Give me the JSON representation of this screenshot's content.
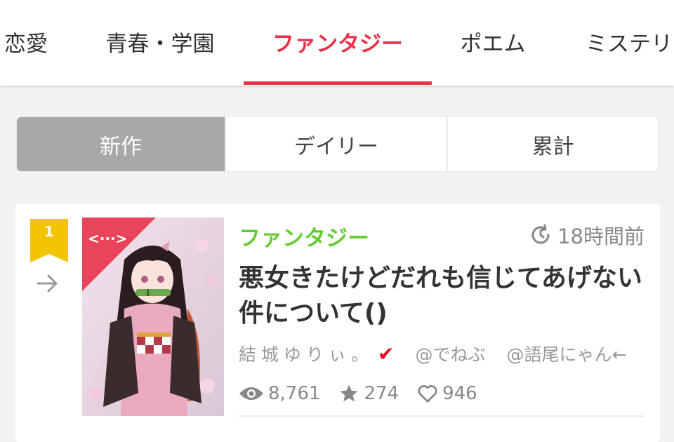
{
  "genre_tabs": [
    {
      "label": "恋愛"
    },
    {
      "label": "青春・学園"
    },
    {
      "label": "ファンタジー",
      "active": true
    },
    {
      "label": "ポエム"
    },
    {
      "label": "ミステリー"
    }
  ],
  "ranking_tabs": [
    {
      "label": "新作",
      "active": true
    },
    {
      "label": "デイリー"
    },
    {
      "label": "累計"
    }
  ],
  "story": {
    "rank": "1",
    "genre": "ファンタジー",
    "time_ago": "18時間前",
    "title": "悪女きたけどだれも信じてあげない件について()",
    "author": "結城ゆりぃ。",
    "collaborators": [
      "@でねぶ",
      "@語尾にゃん←"
    ],
    "views": "8,761",
    "stars": "274",
    "likes": "946",
    "cover_badge": "<···>"
  },
  "colors": {
    "accent": "#e8334a",
    "genre_green": "#66cc33",
    "rank_gold": "#f5c400",
    "segment_active": "#a8a8a8"
  }
}
